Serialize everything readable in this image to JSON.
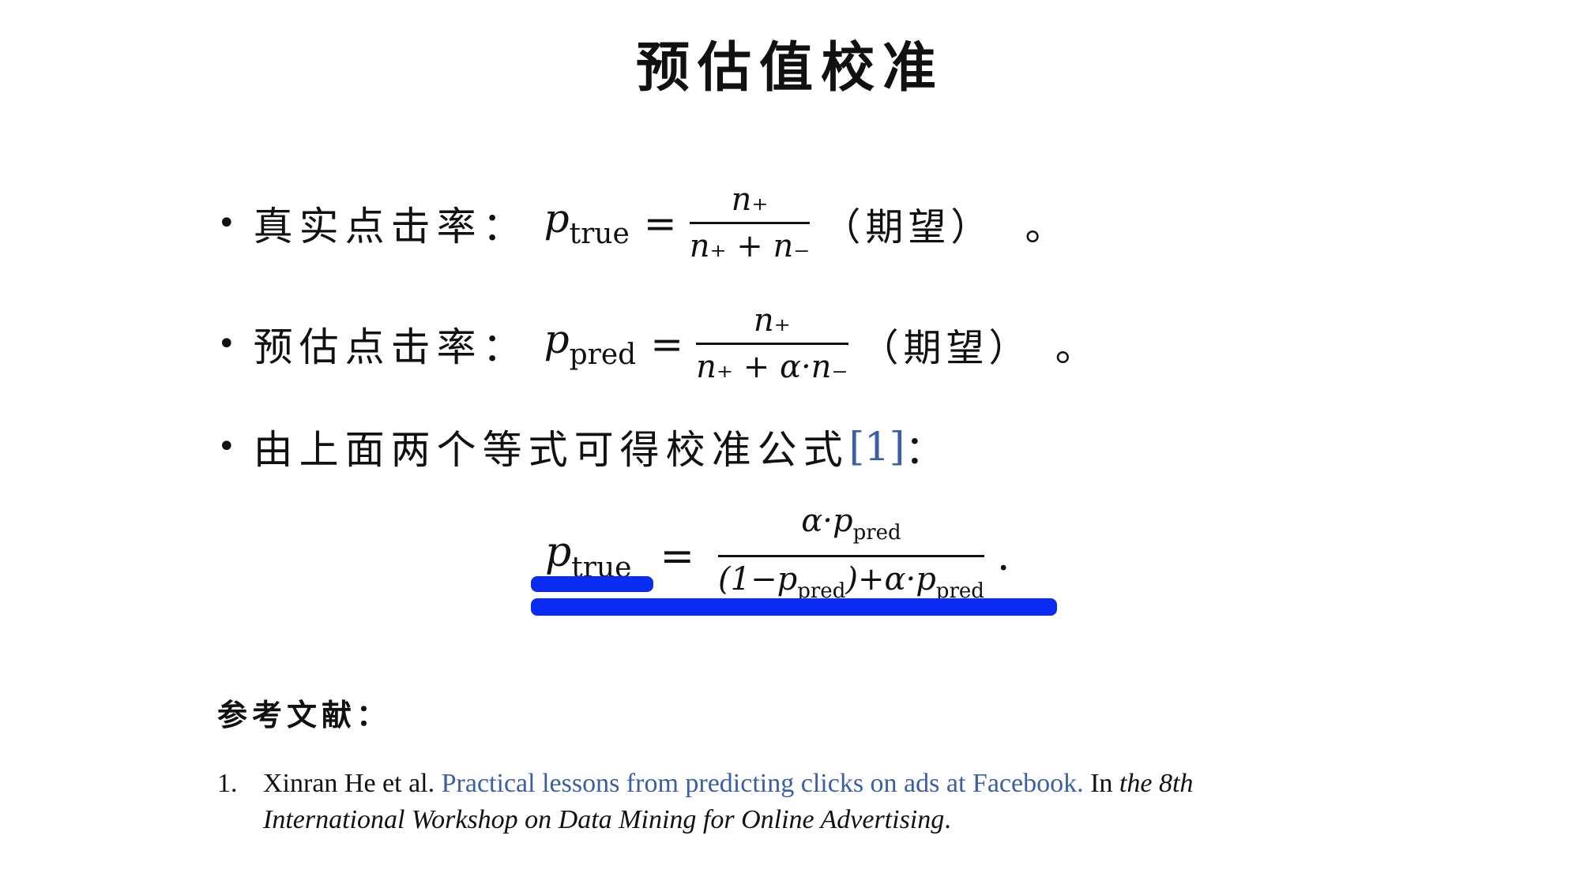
{
  "title": "预估值校准",
  "bullets": [
    {
      "label": "真实点击率：",
      "lhs_var": "p",
      "lhs_sub": "true",
      "eq": "=",
      "num": "n₊",
      "den": "n₊ + n₋",
      "paren": "（期望）",
      "end": "。"
    },
    {
      "label": "预估点击率：",
      "lhs_var": "p",
      "lhs_sub": "pred",
      "eq": "=",
      "num": "n₊",
      "den": "n₊ + α·n₋",
      "paren": "（期望）",
      "end": "。"
    },
    {
      "label_before": "由上面两个等式可得校准公式",
      "ref_link": "[1]",
      "label_after": "："
    }
  ],
  "formula": {
    "lhs_var": "p",
    "lhs_sub": "true",
    "eq": "=",
    "num_prefix": "α·p",
    "num_sub": "pred",
    "den_a": "(1−p",
    "den_a_sub": "pred",
    "den_b": ")+α·p",
    "den_b_sub": "pred",
    "period": "."
  },
  "references": {
    "heading": "参考文献：",
    "items": [
      {
        "number": "1.",
        "authors": "Xinran He et al.",
        "link_title": "Practical lessons from predicting clicks on ads at Facebook.",
        "mid": "In",
        "venue_line1": "the 8th",
        "venue_line2": "International Workshop on Data Mining for Online Advertising",
        "end": "."
      }
    ]
  },
  "colors": {
    "link": "#3b5ea8",
    "highlight": "#0a2cf0",
    "text": "#111111"
  }
}
